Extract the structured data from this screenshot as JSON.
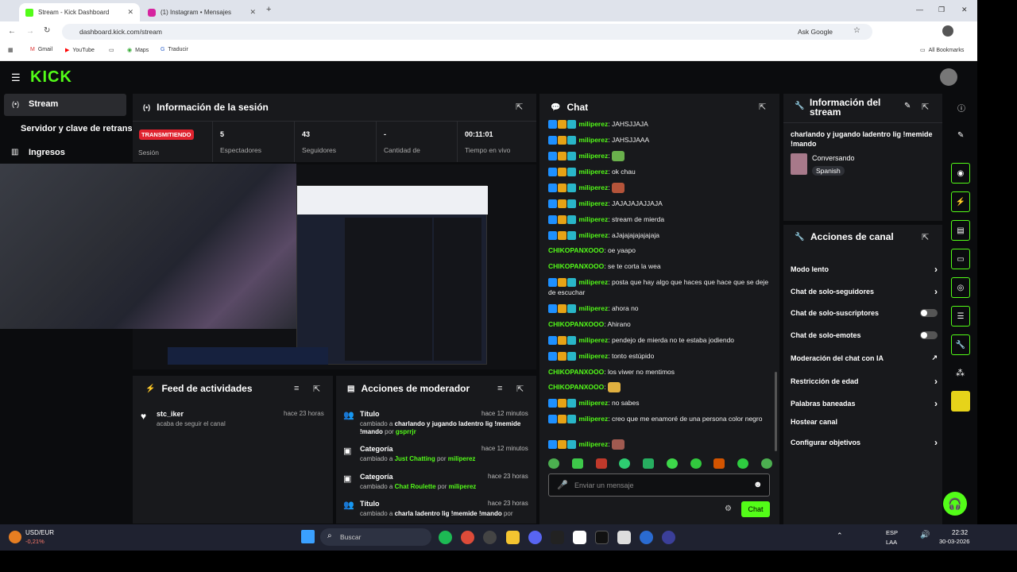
{
  "browser": {
    "tabs": [
      {
        "title": "Stream - Kick Dashboard"
      },
      {
        "title": "(1) Instagram • Mensajes"
      }
    ],
    "url": "dashboard.kick.com/stream",
    "ask_google": "Ask Google",
    "bookmarks": [
      "Gmail",
      "YouTube",
      "Maps",
      "Traducir"
    ],
    "all_bookmarks": "All Bookmarks"
  },
  "nav": {
    "logo": "KICK",
    "items": [
      "Stream",
      "Servidor y clave de retransn",
      "Ingresos"
    ]
  },
  "session": {
    "title": "Información de la sesión",
    "status": "TRANSMITIENDO",
    "status_label": "Sesión",
    "stats": [
      {
        "value": "5",
        "label": "Espectadores"
      },
      {
        "value": "43",
        "label": "Seguidores"
      },
      {
        "value": "-",
        "label": "Cantidad de"
      },
      {
        "value": "00:11:01",
        "label": "Tiempo en vivo"
      }
    ]
  },
  "activity": {
    "title": "Feed de actividades",
    "items": [
      {
        "user": "stc_iker",
        "time": "hace 23 horas",
        "text": "acaba de seguir el canal"
      }
    ]
  },
  "modactions": {
    "title": "Acciones de moderador",
    "items": [
      {
        "type": "Título",
        "time": "hace 12 minutos",
        "prefix": "cambiado a",
        "value": "charlando y jugando ladentro lig !memide !mando",
        "by": "por",
        "user": "gsprrjr"
      },
      {
        "type": "Categoría",
        "time": "hace 12 minutos",
        "prefix": "cambiado a",
        "value": "Just Chatting",
        "by": "por",
        "user": "miliperez"
      },
      {
        "type": "Categoría",
        "time": "hace 23 horas",
        "prefix": "cambiado a",
        "value": "Chat Roulette",
        "by": "por",
        "user": "miliperez"
      },
      {
        "type": "Título",
        "time": "hace 23 horas",
        "prefix": "cambiado a",
        "value": "charla ladentro lig !memide !mando",
        "by": "por",
        "user": ""
      }
    ]
  },
  "chat": {
    "title": "Chat",
    "messages": [
      {
        "user": "miliperez",
        "text": "JAHSJJAJA",
        "badges": true
      },
      {
        "user": "miliperez",
        "text": "JAHSJJAAA",
        "badges": true
      },
      {
        "user": "miliperez",
        "text": "",
        "badges": true,
        "emote": "#6ab04c"
      },
      {
        "user": "miliperez",
        "text": "ok chau",
        "badges": true
      },
      {
        "user": "miliperez",
        "text": "",
        "badges": true,
        "emote": "#b5543a"
      },
      {
        "user": "miliperez",
        "text": "JAJAJAJAJJAJA",
        "badges": true
      },
      {
        "user": "miliperez",
        "text": "stream de mierda",
        "badges": true
      },
      {
        "user": "miliperez",
        "text": "aJajajajajajajaja",
        "badges": true
      },
      {
        "user": "CHIKOPANXOOO",
        "text": "oe yaapo",
        "badges": false
      },
      {
        "user": "CHIKOPANXOOO",
        "text": "se te corta la wea",
        "badges": false
      },
      {
        "user": "miliperez",
        "text": "posta que hay algo que haces que hace que se deje de escuchar",
        "badges": true
      },
      {
        "user": "miliperez",
        "text": "ahora no",
        "badges": true
      },
      {
        "user": "CHIKOPANXOOO",
        "text": "Ahirano",
        "badges": false
      },
      {
        "user": "miliperez",
        "text": "pendejo de mierda no te estaba jodiendo",
        "badges": true
      },
      {
        "user": "miliperez",
        "text": "tonto estúpido",
        "badges": true
      },
      {
        "user": "CHIKOPANXOOO",
        "text": "los viwer no mentimos",
        "badges": false
      },
      {
        "user": "CHIKOPANXOOO",
        "text": "",
        "badges": false,
        "emote": "#e0b040"
      },
      {
        "user": "miliperez",
        "text": "no sabes",
        "badges": true
      },
      {
        "user": "miliperez",
        "text": "creo que me enamoré de una persona color negro",
        "badges": true
      },
      {
        "user": "miliperez",
        "text": "",
        "badges": true,
        "emote": "#a05a50"
      }
    ],
    "input_placeholder": "Enviar un mensaje",
    "send_label": "Chat"
  },
  "stream_info": {
    "title": "Información del stream",
    "stream_title": "charlando y jugando ladentro lig !memide !mando",
    "category": "Conversando",
    "language": "Spanish"
  },
  "channel_actions": {
    "title": "Acciones de canal",
    "items": [
      {
        "label": "Modo lento",
        "control": "arrow"
      },
      {
        "label": "Chat de solo-seguidores",
        "control": "arrow"
      },
      {
        "label": "Chat de solo-suscriptores",
        "control": "toggle"
      },
      {
        "label": "Chat de solo-emotes",
        "control": "toggle"
      },
      {
        "label": "Moderación del chat con IA",
        "control": "external"
      },
      {
        "label": "Restricción de edad",
        "control": "arrow"
      },
      {
        "label": "Palabras baneadas",
        "control": "arrow"
      },
      {
        "label": "Hostear canal",
        "control": "none"
      },
      {
        "label": "Configurar objetivos",
        "control": "arrow"
      }
    ]
  },
  "taskbar": {
    "ticker": "USD/EUR",
    "ticker_change": "-0,21%",
    "search": "Buscar",
    "lang": "ESP",
    "lang2": "LAA",
    "time": "22:32",
    "date": "30-03-2026"
  },
  "colors": {
    "brand": "#53fc18",
    "live": "#e0232f",
    "panel": "#18191c"
  }
}
